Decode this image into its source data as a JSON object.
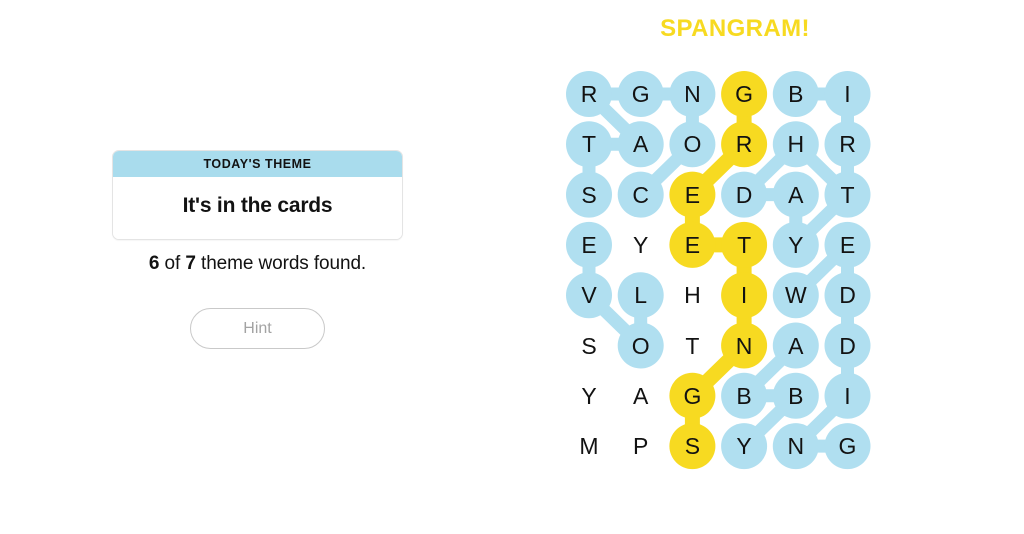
{
  "left": {
    "theme_card": {
      "header_label": "TODAY'S THEME",
      "theme_text": "It's in the cards"
    },
    "progress": {
      "found_count": "6",
      "connector_text": " of ",
      "total_count": "7",
      "suffix_text": " theme words found."
    },
    "hint_button_label": "Hint"
  },
  "board": {
    "spangram_banner_label": "SPANGRAM!",
    "colors": {
      "found_word": "#b0dff0",
      "spangram": "#f7da21",
      "header_blue": "#a9dced",
      "text": "#121212"
    },
    "grid_size": {
      "rows": 8,
      "cols": 6
    },
    "rows": [
      [
        {
          "letter": "R",
          "state": "found"
        },
        {
          "letter": "G",
          "state": "found"
        },
        {
          "letter": "N",
          "state": "found"
        },
        {
          "letter": "G",
          "state": "spangram"
        },
        {
          "letter": "B",
          "state": "found"
        },
        {
          "letter": "I",
          "state": "found"
        }
      ],
      [
        {
          "letter": "T",
          "state": "found"
        },
        {
          "letter": "A",
          "state": "found"
        },
        {
          "letter": "O",
          "state": "found"
        },
        {
          "letter": "R",
          "state": "spangram"
        },
        {
          "letter": "H",
          "state": "found"
        },
        {
          "letter": "R",
          "state": "found"
        }
      ],
      [
        {
          "letter": "S",
          "state": "found"
        },
        {
          "letter": "C",
          "state": "found"
        },
        {
          "letter": "E",
          "state": "spangram"
        },
        {
          "letter": "D",
          "state": "found"
        },
        {
          "letter": "A",
          "state": "found"
        },
        {
          "letter": "T",
          "state": "found"
        }
      ],
      [
        {
          "letter": "E",
          "state": "found"
        },
        {
          "letter": "Y",
          "state": "plain"
        },
        {
          "letter": "E",
          "state": "spangram"
        },
        {
          "letter": "T",
          "state": "spangram"
        },
        {
          "letter": "Y",
          "state": "found"
        },
        {
          "letter": "E",
          "state": "found"
        }
      ],
      [
        {
          "letter": "V",
          "state": "found"
        },
        {
          "letter": "L",
          "state": "found"
        },
        {
          "letter": "H",
          "state": "plain"
        },
        {
          "letter": "I",
          "state": "spangram"
        },
        {
          "letter": "W",
          "state": "found"
        },
        {
          "letter": "D",
          "state": "found"
        }
      ],
      [
        {
          "letter": "S",
          "state": "plain"
        },
        {
          "letter": "O",
          "state": "found"
        },
        {
          "letter": "T",
          "state": "plain"
        },
        {
          "letter": "N",
          "state": "spangram"
        },
        {
          "letter": "A",
          "state": "found"
        },
        {
          "letter": "D",
          "state": "found"
        }
      ],
      [
        {
          "letter": "Y",
          "state": "plain"
        },
        {
          "letter": "A",
          "state": "plain"
        },
        {
          "letter": "G",
          "state": "spangram"
        },
        {
          "letter": "B",
          "state": "found"
        },
        {
          "letter": "B",
          "state": "found"
        },
        {
          "letter": "I",
          "state": "found"
        }
      ],
      [
        {
          "letter": "M",
          "state": "plain"
        },
        {
          "letter": "P",
          "state": "plain"
        },
        {
          "letter": "S",
          "state": "spangram"
        },
        {
          "letter": "Y",
          "state": "found"
        },
        {
          "letter": "N",
          "state": "found"
        },
        {
          "letter": "G",
          "state": "found"
        }
      ]
    ],
    "spangram_path": [
      [
        0,
        3
      ],
      [
        1,
        3
      ],
      [
        2,
        2
      ],
      [
        3,
        2
      ],
      [
        3,
        3
      ],
      [
        4,
        3
      ],
      [
        5,
        3
      ],
      [
        6,
        2
      ],
      [
        7,
        2
      ]
    ],
    "found_paths": [
      [
        [
          0,
          0
        ],
        [
          0,
          1
        ],
        [
          0,
          2
        ]
      ],
      [
        [
          0,
          0
        ],
        [
          1,
          1
        ],
        [
          1,
          0
        ],
        [
          2,
          0
        ]
      ],
      [
        [
          0,
          2
        ],
        [
          1,
          2
        ],
        [
          2,
          1
        ]
      ],
      [
        [
          0,
          4
        ],
        [
          0,
          5
        ],
        [
          1,
          5
        ],
        [
          2,
          5
        ],
        [
          1,
          4
        ],
        [
          2,
          3
        ],
        [
          2,
          4
        ],
        [
          3,
          4
        ],
        [
          2,
          5
        ]
      ],
      [
        [
          3,
          5
        ],
        [
          4,
          4
        ]
      ],
      [
        [
          3,
          5
        ],
        [
          4,
          5
        ],
        [
          5,
          5
        ],
        [
          6,
          5
        ],
        [
          7,
          4
        ],
        [
          7,
          5
        ]
      ],
      [
        [
          5,
          4
        ],
        [
          6,
          3
        ],
        [
          6,
          4
        ],
        [
          7,
          3
        ]
      ],
      [
        [
          3,
          0
        ],
        [
          4,
          0
        ],
        [
          5,
          1
        ],
        [
          4,
          1
        ]
      ]
    ]
  }
}
